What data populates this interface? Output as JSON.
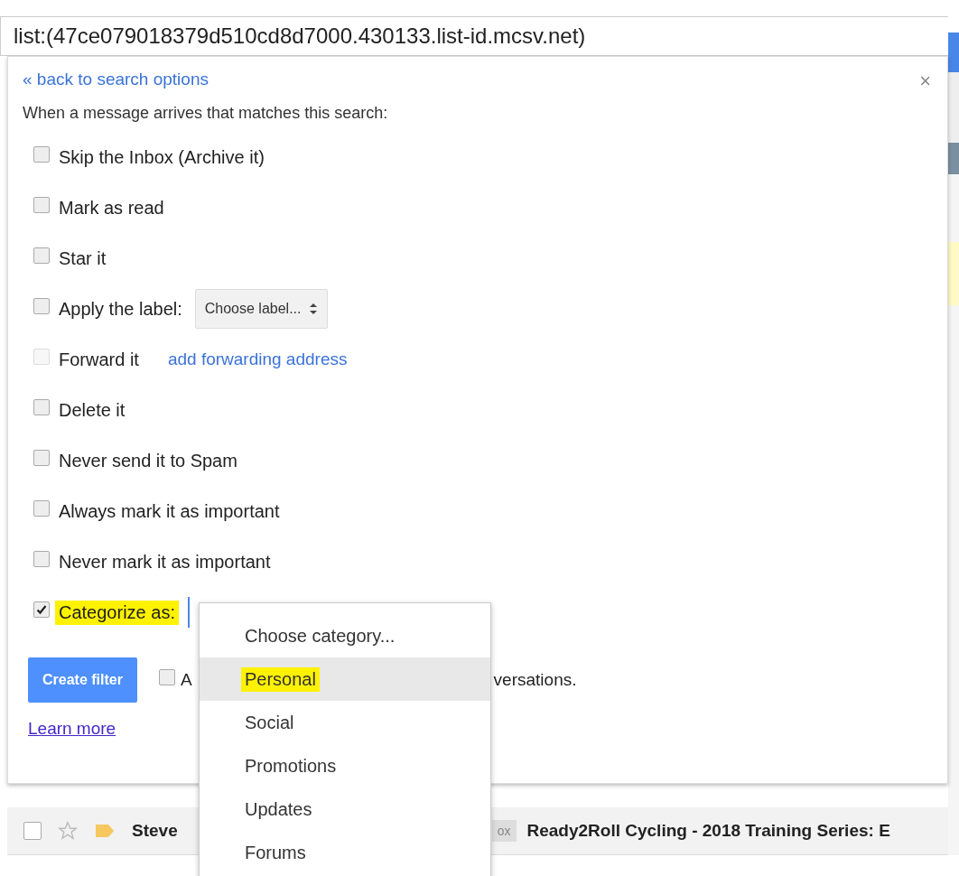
{
  "search_query": "list:(47ce079018379d510cd8d7000.430133.list-id.mcsv.net)",
  "panel": {
    "back_link": "« back to search options",
    "close": "×",
    "intro": "When a message arrives that matches this search:",
    "options": [
      {
        "kind": "checkbox",
        "label": "Skip the Inbox (Archive it)",
        "checked": false,
        "disabled": false,
        "highlighted": false
      },
      {
        "kind": "checkbox",
        "label": "Mark as read",
        "checked": false,
        "disabled": false,
        "highlighted": false
      },
      {
        "kind": "checkbox",
        "label": "Star it",
        "checked": false,
        "disabled": false,
        "highlighted": false
      },
      {
        "kind": "select",
        "label": "Apply the label:",
        "checked": false,
        "disabled": false,
        "highlighted": false,
        "select": "Choose label..."
      },
      {
        "kind": "link",
        "label": "Forward it",
        "checked": false,
        "disabled": true,
        "highlighted": false,
        "link": "add forwarding address"
      },
      {
        "kind": "checkbox",
        "label": "Delete it",
        "checked": false,
        "disabled": false,
        "highlighted": false
      },
      {
        "kind": "checkbox",
        "label": "Never send it to Spam",
        "checked": false,
        "disabled": false,
        "highlighted": false
      },
      {
        "kind": "checkbox",
        "label": "Always mark it as important",
        "checked": false,
        "disabled": false,
        "highlighted": false
      },
      {
        "kind": "checkbox",
        "label": "Never mark it as important",
        "checked": false,
        "disabled": false,
        "highlighted": false
      },
      {
        "kind": "category",
        "label": "Categorize as:",
        "checked": true,
        "disabled": false,
        "highlighted": true
      }
    ],
    "create_button": "Create filter",
    "also_apply": {
      "checked": false,
      "text_start": "A",
      "text_end": "versations."
    },
    "learn_more": "Learn more"
  },
  "category_menu": [
    {
      "label": "Choose category...",
      "selected": false,
      "highlighted": false
    },
    {
      "label": "Personal",
      "selected": true,
      "highlighted": true
    },
    {
      "label": "Social",
      "selected": false,
      "highlighted": false
    },
    {
      "label": "Promotions",
      "selected": false,
      "highlighted": false
    },
    {
      "label": "Updates",
      "selected": false,
      "highlighted": false
    },
    {
      "label": "Forums",
      "selected": false,
      "highlighted": false
    }
  ],
  "inbox_row": {
    "checked": false,
    "starred": false,
    "sender": "Steve",
    "badge": "ox",
    "subject": "Ready2Roll Cycling - 2018 Training Series: E"
  }
}
